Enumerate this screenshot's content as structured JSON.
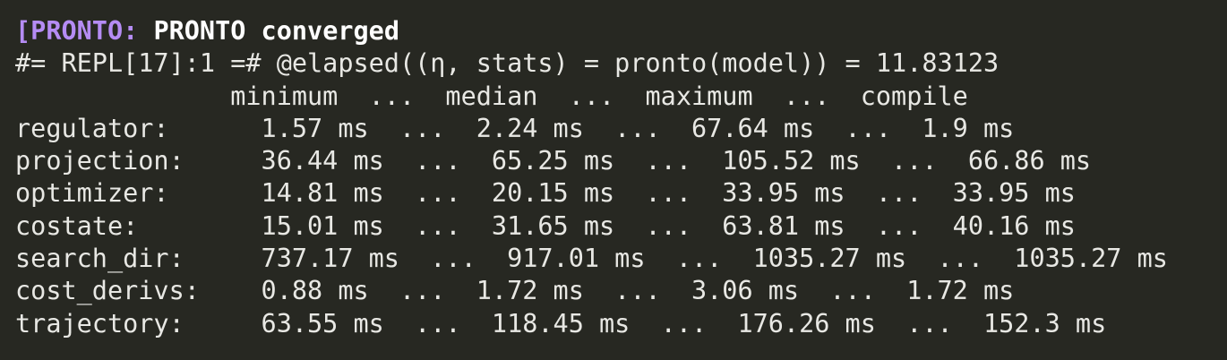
{
  "terminal": {
    "status": {
      "prefix": "[PRONTO:",
      "message": "PRONTO converged"
    },
    "command": "#= REPL[17]:1 =# @elapsed((η, stats) = pronto(model)) = 11.83123",
    "header": "              minimum  ...  median  ...  maximum  ...  compile",
    "rows": [
      "regulator:      1.57 ms  ...  2.24 ms  ...  67.64 ms  ...  1.9 ms",
      "projection:     36.44 ms  ...  65.25 ms  ...  105.52 ms  ...  66.86 ms",
      "optimizer:      14.81 ms  ...  20.15 ms  ...  33.95 ms  ...  33.95 ms",
      "costate:        15.01 ms  ...  31.65 ms  ...  63.81 ms  ...  40.16 ms",
      "search_dir:     737.17 ms  ...  917.01 ms  ...  1035.27 ms  ...  1035.27 ms",
      "cost_derivs:    0.88 ms  ...  1.72 ms  ...  3.06 ms  ...  1.72 ms",
      "trajectory:     63.55 ms  ...  118.45 ms  ...  176.26 ms  ...  152.3 ms"
    ],
    "colors": {
      "background": "#272822",
      "text": "#e8e8e4",
      "prompt_tag": "#b58cf4"
    }
  }
}
